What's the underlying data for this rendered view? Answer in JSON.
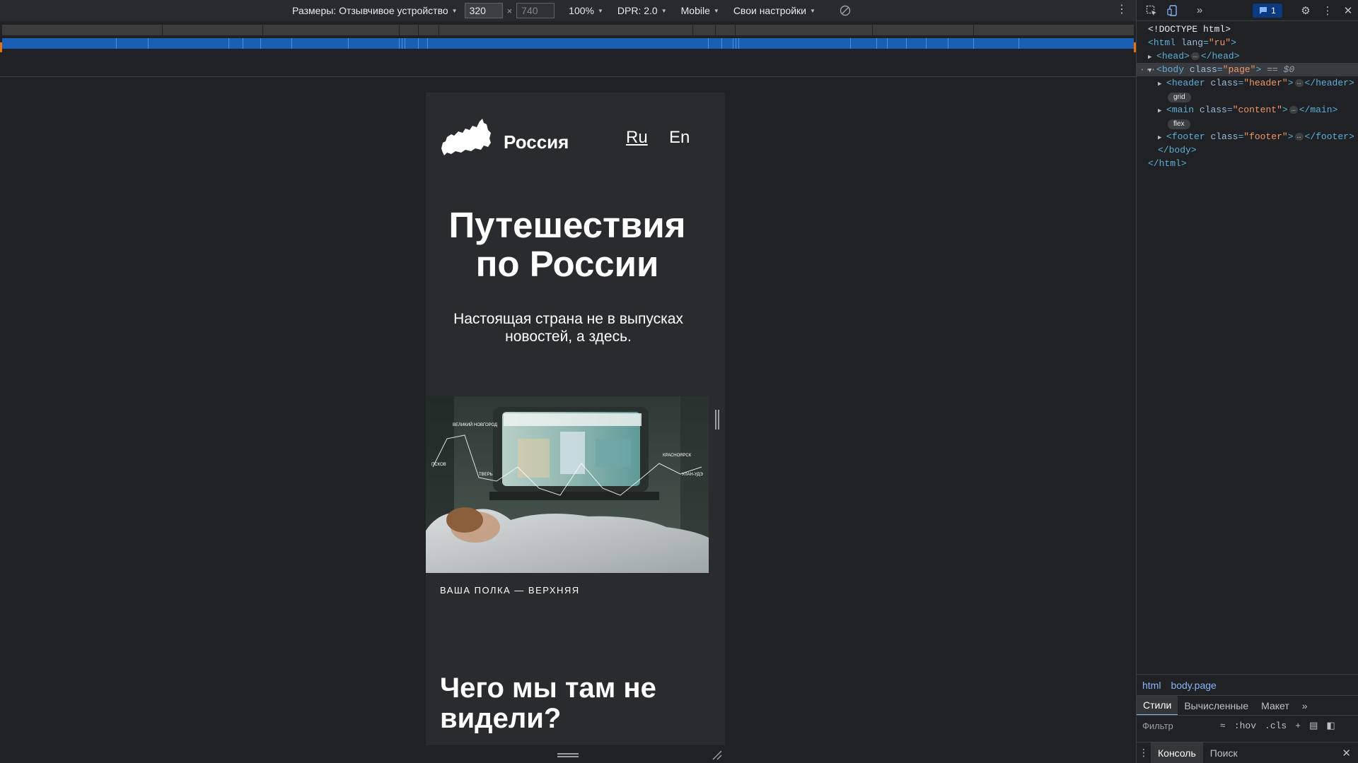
{
  "device_toolbar": {
    "dimensions_label": "Размеры: Отзывчивое устройство",
    "width": "320",
    "height": "740",
    "times": "×",
    "zoom": "100%",
    "dpr": "DPR: 2.0",
    "device_type": "Mobile",
    "throttling": "Свои настройки"
  },
  "page": {
    "logo_text": "Россия",
    "lang_ru": "Ru",
    "lang_en": "En",
    "hero_title": "Путешествия по России",
    "hero_subtitle": "Настоящая страна не в выпусках новостей, а здесь.",
    "image_caption": "ВАША ПОЛКА — ВЕРХНЯЯ",
    "section_title": "Чего мы там не видели?",
    "map_labels": {
      "l1": "ВЕЛИКИЙ НОВГОРОД",
      "l2": "ПСКОВ",
      "l3": "ТВЕРЬ",
      "l4": "КРАСНОЯРСК",
      "l5": "УЛАН-УДЭ"
    }
  },
  "devtools": {
    "issues_count": "1",
    "dom": {
      "doctype": "<!DOCTYPE html>",
      "html_tag": "html",
      "html_attr": "lang",
      "html_val": "\"ru\"",
      "head_tag": "head",
      "body_tag": "body",
      "body_attr": "class",
      "body_val": "\"page\"",
      "body_suffix": "== $0",
      "header_tag": "header",
      "header_attr": "class",
      "header_val": "\"header\"",
      "header_badge": "grid",
      "main_tag": "main",
      "main_attr": "class",
      "main_val": "\"content\"",
      "main_badge": "flex",
      "footer_tag": "footer",
      "footer_attr": "class",
      "footer_val": "\"footer\"",
      "body_close": "</body>",
      "html_close": "</html>"
    },
    "breadcrumbs": [
      "html",
      "body.page"
    ],
    "style_tabs": [
      "Стили",
      "Вычисленные",
      "Макет"
    ],
    "filter_placeholder": "Фильтр",
    "filter_hov": ":hov",
    "filter_cls": ".cls",
    "drawer_tabs": [
      "Консоль",
      "Поиск"
    ]
  }
}
